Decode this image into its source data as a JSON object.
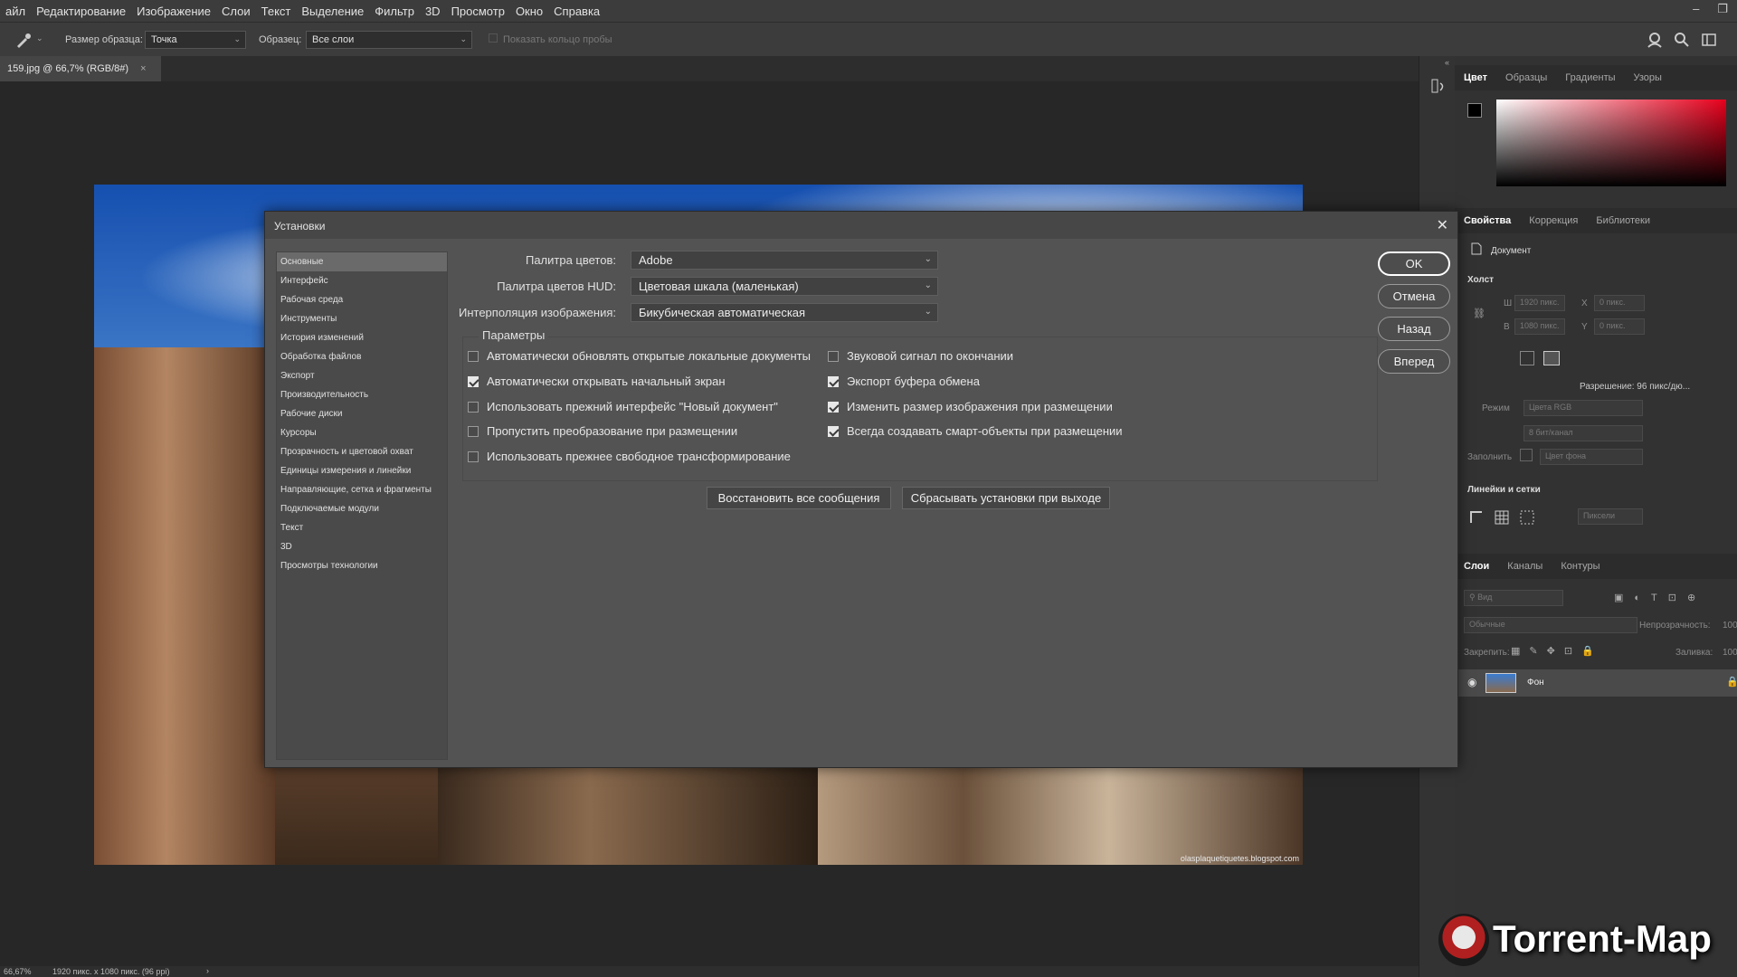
{
  "menu": [
    "айл",
    "Редактирование",
    "Изображение",
    "Слои",
    "Текст",
    "Выделение",
    "Фильтр",
    "3D",
    "Просмотр",
    "Окно",
    "Справка"
  ],
  "window_controls": {
    "minimize": "–",
    "restore": "❐"
  },
  "options": {
    "sample_size_label": "Размер образца:",
    "sample_size_value": "Точка",
    "sample_label": "Образец:",
    "sample_value": "Все слои",
    "show_ring_label": "Показать кольцо пробы"
  },
  "doc_tab": {
    "title": "159.jpg @ 66,7% (RGB/8#)",
    "close": "×"
  },
  "photo_credit": "olasplaquetiquetes.blogspot.com",
  "status": {
    "zoom": "66,67%",
    "doc_info": "1920 пикс. x 1080 пикс. (96 ppi)",
    "arrow": "›"
  },
  "panels": {
    "color_tabs": [
      "Цвет",
      "Образцы",
      "Градиенты",
      "Узоры"
    ],
    "props_tabs": [
      "Свойства",
      "Коррекция",
      "Библиотеки"
    ],
    "document_label": "Документ",
    "canvas_label": "Холст",
    "w_label": "Ш",
    "w_value": "1920 пикс.",
    "h_label": "В",
    "h_value": "1080 пикс.",
    "x_label": "X",
    "x_value": "0 пикс.",
    "y_label": "Y",
    "y_value": "0 пикс.",
    "resolution": "Разрешение: 96 пикс/дю...",
    "mode_label": "Режим",
    "mode_value": "Цвета RGB",
    "bits_value": "8 бит/канал",
    "fill_label": "Заполнить",
    "fill_value": "Цвет фона",
    "rulers_label": "Линейки и сетки",
    "units_value": "Пиксели",
    "layers_tabs": [
      "Слои",
      "Каналы",
      "Контуры"
    ],
    "layers_search": "Вид",
    "blend_mode": "Обычные",
    "opacity_label": "Непрозрачность:",
    "opacity_value": "100",
    "lock_label": "Закрепить:",
    "fill2_label": "Заливка:",
    "fill2_value": "100",
    "layer_name": "Фон"
  },
  "dialog": {
    "title": "Установки",
    "close": "✕",
    "nav": [
      "Основные",
      "Интерфейс",
      "Рабочая среда",
      "Инструменты",
      "История изменений",
      "Обработка файлов",
      "Экспорт",
      "Производительность",
      "Рабочие диски",
      "Курсоры",
      "Прозрачность и цветовой охват",
      "Единицы измерения и линейки",
      "Направляющие, сетка и фрагменты",
      "Подключаемые модули",
      "Текст",
      "3D",
      "Просмотры технологии"
    ],
    "color_picker_label": "Палитра цветов:",
    "color_picker_value": "Adobe",
    "hud_picker_label": "Палитра цветов HUD:",
    "hud_picker_value": "Цветовая шкала (маленькая)",
    "interp_label": "Интерполяция изображения:",
    "interp_value": "Бикубическая автоматическая",
    "params_label": "Параметры",
    "checks_left": [
      {
        "label": "Автоматически обновлять открытые локальные документы",
        "checked": false
      },
      {
        "label": "Автоматически открывать начальный экран",
        "checked": true
      },
      {
        "label": "Использовать прежний интерфейс \"Новый документ\"",
        "checked": false
      },
      {
        "label": "Пропустить преобразование при размещении",
        "checked": false
      },
      {
        "label": "Использовать прежнее свободное трансформирование",
        "checked": false
      }
    ],
    "checks_right": [
      {
        "label": "Звуковой сигнал по окончании",
        "checked": false
      },
      {
        "label": "Экспорт буфера обмена",
        "checked": true
      },
      {
        "label": "Изменить размер изображения при размещении",
        "checked": true
      },
      {
        "label": "Всегда создавать смарт-объекты при размещении",
        "checked": true
      }
    ],
    "restore_messages": "Восстановить все сообщения",
    "reset_on_exit": "Сбрасывать установки при выходе",
    "ok": "OK",
    "cancel": "Отмена",
    "prev": "Назад",
    "next": "Вперед"
  },
  "watermark": "Torrent-Map"
}
